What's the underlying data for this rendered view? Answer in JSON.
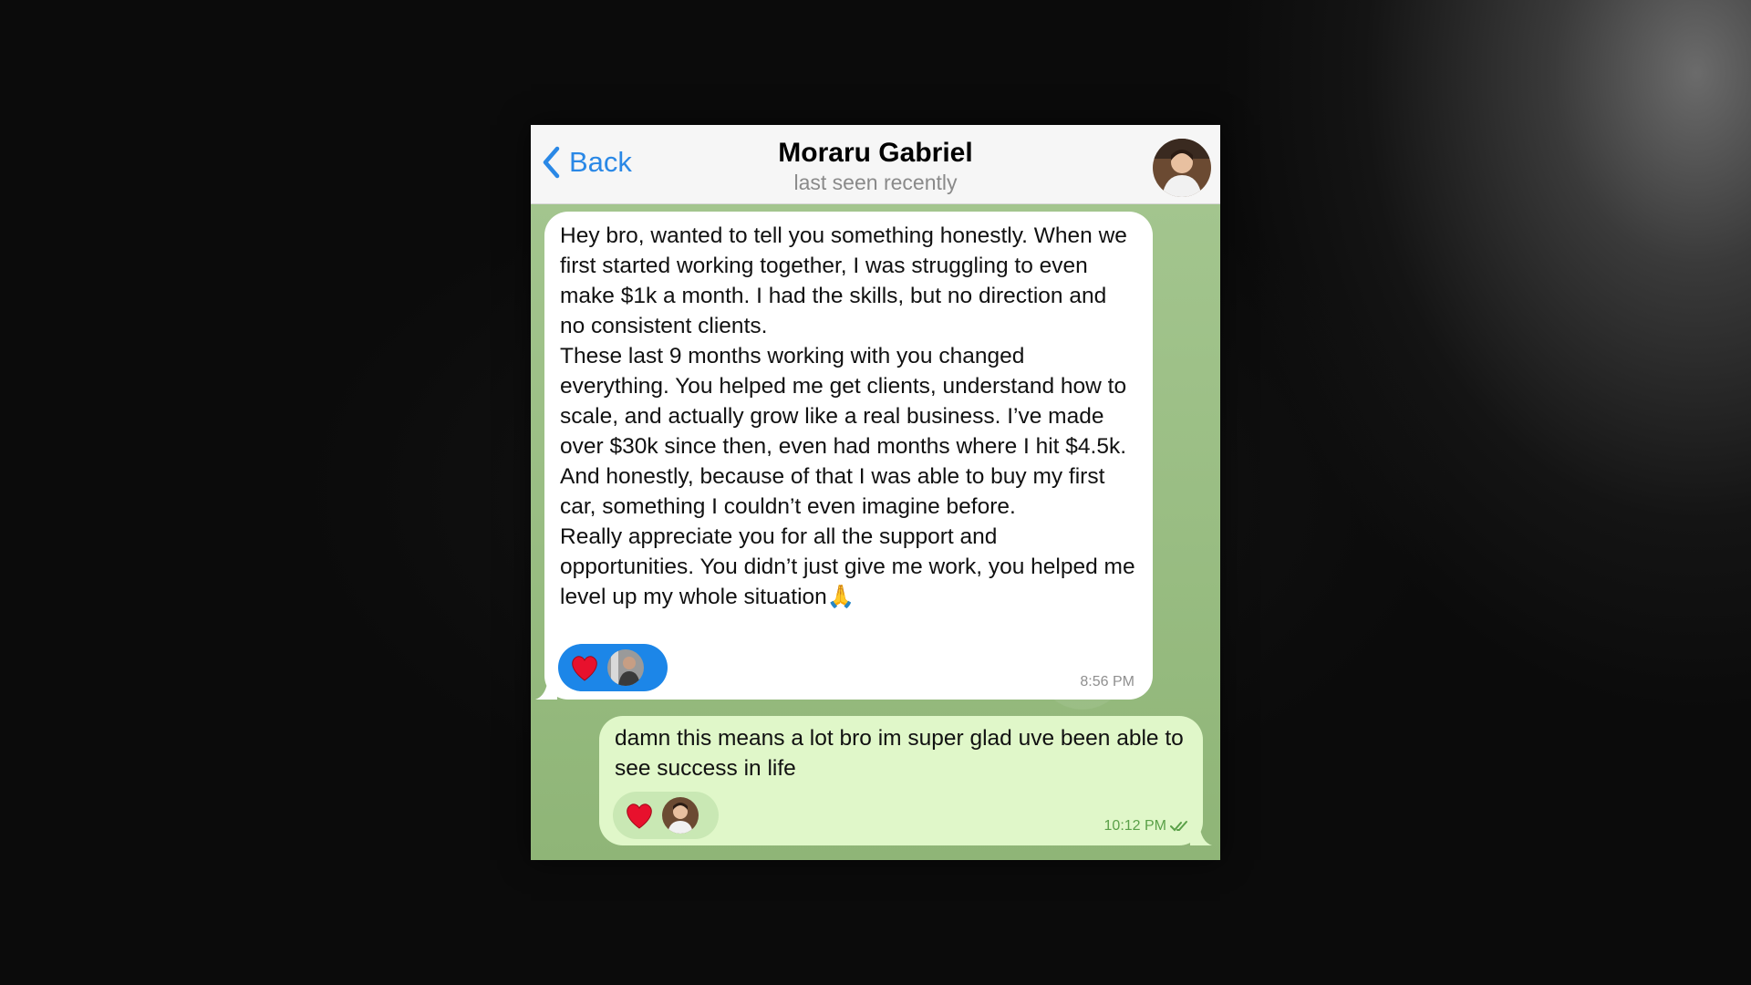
{
  "header": {
    "back_label": "Back",
    "contact_name": "Moraru Gabriel",
    "status": "last seen recently"
  },
  "messages": [
    {
      "direction": "incoming",
      "paragraphs": [
        "Hey bro, wanted to tell you something honestly. When we first started working together, I was struggling to even make $1k a month. I had the skills, but no direction and no consistent clients.",
        "These last 9 months working with you changed everything. You helped me get clients, understand how to scale, and actually grow like a real business. I’ve made over $30k since then, even had months where I hit $4.5k.",
        "And honestly, because of that I was able to buy my first car, something I couldn’t even imagine before.",
        "Really appreciate you for all the support and opportunities. You didn’t just give me work, you helped me level up my whole situation🙏"
      ],
      "reaction": "heart",
      "time": "8:56 PM"
    },
    {
      "direction": "outgoing",
      "text": "damn this means a lot bro im super glad uve been able to see success in life",
      "reaction": "heart",
      "time": "10:12 PM",
      "read": true
    }
  ],
  "colors": {
    "accent": "#2a88e6",
    "incoming_bubble": "#ffffff",
    "outgoing_bubble": "#e0f7c9",
    "wallpaper": "#9bbc86",
    "reaction_incoming": "#1c86e8",
    "reaction_outgoing": "#c9e8b4",
    "heart": "#e8112d"
  },
  "icons": {
    "back": "chevron-left-icon",
    "reaction": "heart-icon",
    "read_receipt": "double-check-icon"
  }
}
